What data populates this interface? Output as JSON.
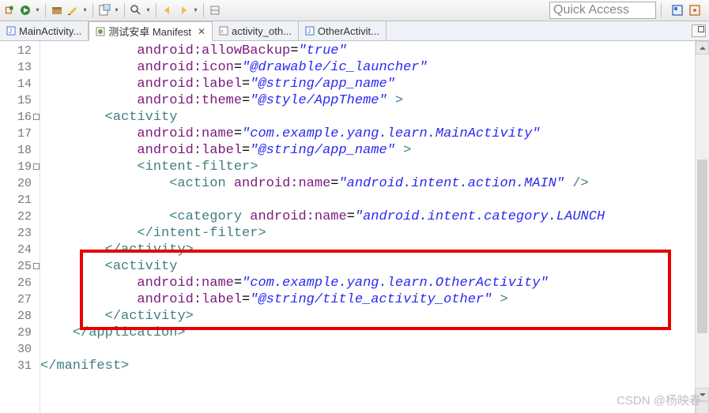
{
  "quick_access": "Quick Access",
  "tabs": [
    {
      "label": "MainActivity...",
      "active": false
    },
    {
      "label": "测试安卓 Manifest",
      "active": true
    },
    {
      "label": "activity_oth...",
      "active": false
    },
    {
      "label": "OtherActivit...",
      "active": false
    }
  ],
  "gutter": {
    "start": 12,
    "lines": [
      {
        "n": "12"
      },
      {
        "n": "13"
      },
      {
        "n": "14"
      },
      {
        "n": "15"
      },
      {
        "n": "16",
        "fold": true
      },
      {
        "n": "17"
      },
      {
        "n": "18"
      },
      {
        "n": "19",
        "fold": true
      },
      {
        "n": "20"
      },
      {
        "n": "21"
      },
      {
        "n": "22"
      },
      {
        "n": "23"
      },
      {
        "n": "24"
      },
      {
        "n": "25",
        "fold": true
      },
      {
        "n": "26"
      },
      {
        "n": "27"
      },
      {
        "n": "28"
      },
      {
        "n": "29"
      },
      {
        "n": "30"
      },
      {
        "n": "31"
      }
    ]
  },
  "code": {
    "l12a": "            ",
    "l12attr": "android:allowBackup",
    "l12val": "\"true\"",
    "l13a": "            ",
    "l13attr": "android:icon",
    "l13val": "\"@drawable/ic_launcher\"",
    "l14a": "            ",
    "l14attr": "android:label",
    "l14val": "\"@string/app_name\"",
    "l15a": "            ",
    "l15attr": "android:theme",
    "l15val": "\"@style/AppTheme\"",
    "l15end": " >",
    "l16a": "        ",
    "l16tag": "<activity",
    "l17a": "            ",
    "l17attr": "android:name",
    "l17val": "\"com.example.yang.learn.MainActivity\"",
    "l18a": "            ",
    "l18attr": "android:label",
    "l18val": "\"@string/app_name\"",
    "l18end": " >",
    "l19a": "            ",
    "l19tag": "<intent-filter>",
    "l20a": "                ",
    "l20tag1": "<action ",
    "l20attr": "android:name",
    "l20val": "\"android.intent.action.MAIN\"",
    "l20tag2": " />",
    "l22a": "                ",
    "l22tag1": "<category ",
    "l22attr": "android:name",
    "l22val": "\"android.intent.category.LAUNCH",
    "l22tag2": "",
    "l23a": "            ",
    "l23tag": "</intent-filter>",
    "l24a": "        ",
    "l24tag": "</activity>",
    "l25a": "        ",
    "l25tag": "<activity",
    "l26a": "            ",
    "l26attr": "android:name",
    "l26val": "\"com.example.yang.learn.OtherActivity\"",
    "l27a": "            ",
    "l27attr": "android:label",
    "l27val": "\"@string/title_activity_other\"",
    "l27end": " >",
    "l28a": "        ",
    "l28tag": "</activity>",
    "l29a": "    ",
    "l29tag": "</application>",
    "l31tag": "</manifest>"
  },
  "watermark": "CSDN @杨映春"
}
